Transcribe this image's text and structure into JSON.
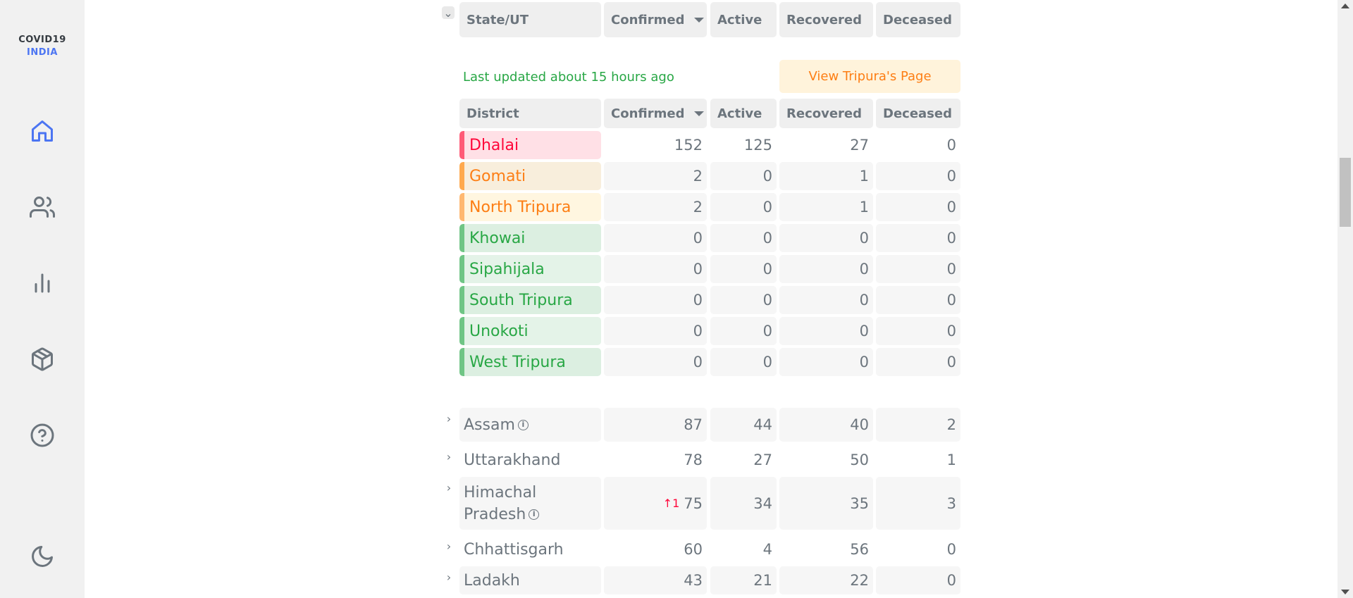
{
  "logo": {
    "line1": "COVID19",
    "line2": "INDIA"
  },
  "nav": [
    {
      "name": "home-icon"
    },
    {
      "name": "people-icon"
    },
    {
      "name": "bar-chart-icon"
    },
    {
      "name": "box-icon"
    },
    {
      "name": "help-icon"
    },
    {
      "name": "moon-icon"
    }
  ],
  "state_header": {
    "name": "State/UT",
    "confirmed": "Confirmed",
    "active": "Active",
    "recovered": "Recovered",
    "deceased": "Deceased"
  },
  "expanded": {
    "last_updated": "Last updated about 15 hours ago",
    "view_button": "View Tripura's Page",
    "header": {
      "name": "District",
      "confirmed": "Confirmed",
      "active": "Active",
      "recovered": "Recovered",
      "deceased": "Deceased"
    },
    "districts": [
      {
        "name": "Dhalai",
        "confirmed": "152",
        "active": "125",
        "recovered": "27",
        "deceased": "0",
        "color": "#ff073a",
        "bg": "#ffe0e6",
        "bar": "#ff5a77"
      },
      {
        "name": "Gomati",
        "confirmed": "2",
        "active": "0",
        "recovered": "1",
        "deceased": "0",
        "color": "#fd7e14",
        "bg": "#f8eedc",
        "bar": "#ffa94d"
      },
      {
        "name": "North Tripura",
        "confirmed": "2",
        "active": "0",
        "recovered": "1",
        "deceased": "0",
        "color": "#fd7e14",
        "bg": "#fff6e0",
        "bar": "#ffb870"
      },
      {
        "name": "Khowai",
        "confirmed": "0",
        "active": "0",
        "recovered": "0",
        "deceased": "0",
        "color": "#28a745",
        "bg": "#dcefe1",
        "bar": "#6fc585"
      },
      {
        "name": "Sipahijala",
        "confirmed": "0",
        "active": "0",
        "recovered": "0",
        "deceased": "0",
        "color": "#28a745",
        "bg": "#e4f3e8",
        "bar": "#6fc585"
      },
      {
        "name": "South Tripura",
        "confirmed": "0",
        "active": "0",
        "recovered": "0",
        "deceased": "0",
        "color": "#28a745",
        "bg": "#dcefe1",
        "bar": "#6fc585"
      },
      {
        "name": "Unokoti",
        "confirmed": "0",
        "active": "0",
        "recovered": "0",
        "deceased": "0",
        "color": "#28a745",
        "bg": "#e4f3e8",
        "bar": "#6fc585"
      },
      {
        "name": "West Tripura",
        "confirmed": "0",
        "active": "0",
        "recovered": "0",
        "deceased": "0",
        "color": "#28a745",
        "bg": "#dcefe1",
        "bar": "#6fc585"
      }
    ]
  },
  "states": [
    {
      "name": "Assam",
      "info": true,
      "confirmed": "87",
      "delta": "",
      "active": "44",
      "recovered": "40",
      "deceased": "2"
    },
    {
      "name": "Uttarakhand",
      "info": false,
      "confirmed": "78",
      "delta": "",
      "active": "27",
      "recovered": "50",
      "deceased": "1"
    },
    {
      "name_line1": "Himachal",
      "name_line2": "Pradesh",
      "info": true,
      "confirmed": "75",
      "delta": "↑1",
      "active": "34",
      "recovered": "35",
      "deceased": "3"
    },
    {
      "name": "Chhattisgarh",
      "info": false,
      "confirmed": "60",
      "delta": "",
      "active": "4",
      "recovered": "56",
      "deceased": "0"
    },
    {
      "name": "Ladakh",
      "info": false,
      "confirmed": "43",
      "delta": "",
      "active": "21",
      "recovered": "22",
      "deceased": "0"
    }
  ],
  "info_glyph": "i"
}
